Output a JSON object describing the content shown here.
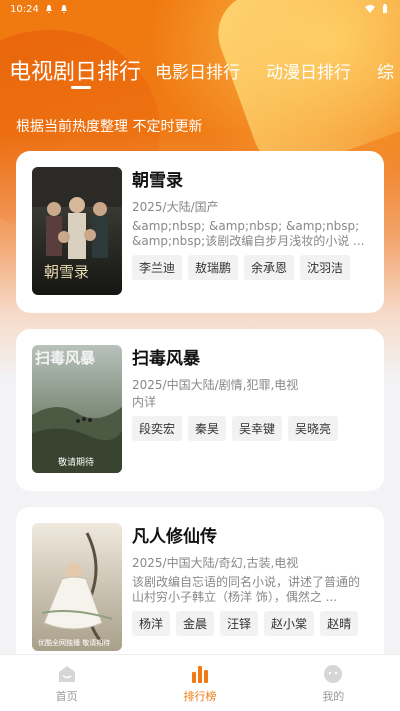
{
  "status_bar": {
    "time": "10:24",
    "icons": [
      "notification-icon",
      "notification-icon",
      "wifi-icon",
      "battery-icon"
    ]
  },
  "tabs": [
    {
      "label": "电视剧日排行",
      "active": true
    },
    {
      "label": "电影日排行",
      "active": false
    },
    {
      "label": "动漫日排行",
      "active": false
    },
    {
      "label": "综",
      "active": false
    }
  ],
  "subtitle": "根据当前热度整理 不定时更新",
  "items": [
    {
      "title": "朝雪录",
      "meta": "2025/大陆/国产",
      "desc": "&amp;nbsp; &amp;nbsp; &amp;nbsp; &amp;nbsp;该剧改编自步月浅妆的小说 ...",
      "cast": [
        "李兰迪",
        "敖瑞鹏",
        "余承恩",
        "沈羽洁"
      ],
      "poster_colors": [
        "#3a3a35",
        "#1c1c1a"
      ]
    },
    {
      "title": "扫毒风暴",
      "meta": "2025/中国大陆/剧情,犯罪,电视",
      "desc": "内详",
      "cast": [
        "段奕宏",
        "秦昊",
        "吴幸键",
        "吴晓亮"
      ],
      "poster_colors": [
        "#9aa6a0",
        "#3e4a3a"
      ]
    },
    {
      "title": "凡人修仙传",
      "meta": "2025/中国大陆/奇幻,古装,电视",
      "desc": "该剧改编自忘语的同名小说，讲述了普通的山村穷小子韩立（杨洋 饰），偶然之 ...",
      "cast": [
        "杨洋",
        "金晨",
        "汪铎",
        "赵小棠",
        "赵晴"
      ],
      "poster_colors": [
        "#e8e2d6",
        "#b8ae9a"
      ]
    }
  ],
  "poster_texts": [
    "朝雪录",
    "扫毒风暴",
    "敬请期待",
    "优酷全网独播 敬请期待"
  ],
  "bottom_nav": [
    {
      "label": "首页",
      "icon": "home-icon",
      "active": false
    },
    {
      "label": "排行榜",
      "icon": "ranking-chart-icon",
      "active": true
    },
    {
      "label": "我的",
      "icon": "profile-icon",
      "active": false
    }
  ],
  "colors": {
    "accent": "#f07a14",
    "hero_top": "#f0790f"
  }
}
